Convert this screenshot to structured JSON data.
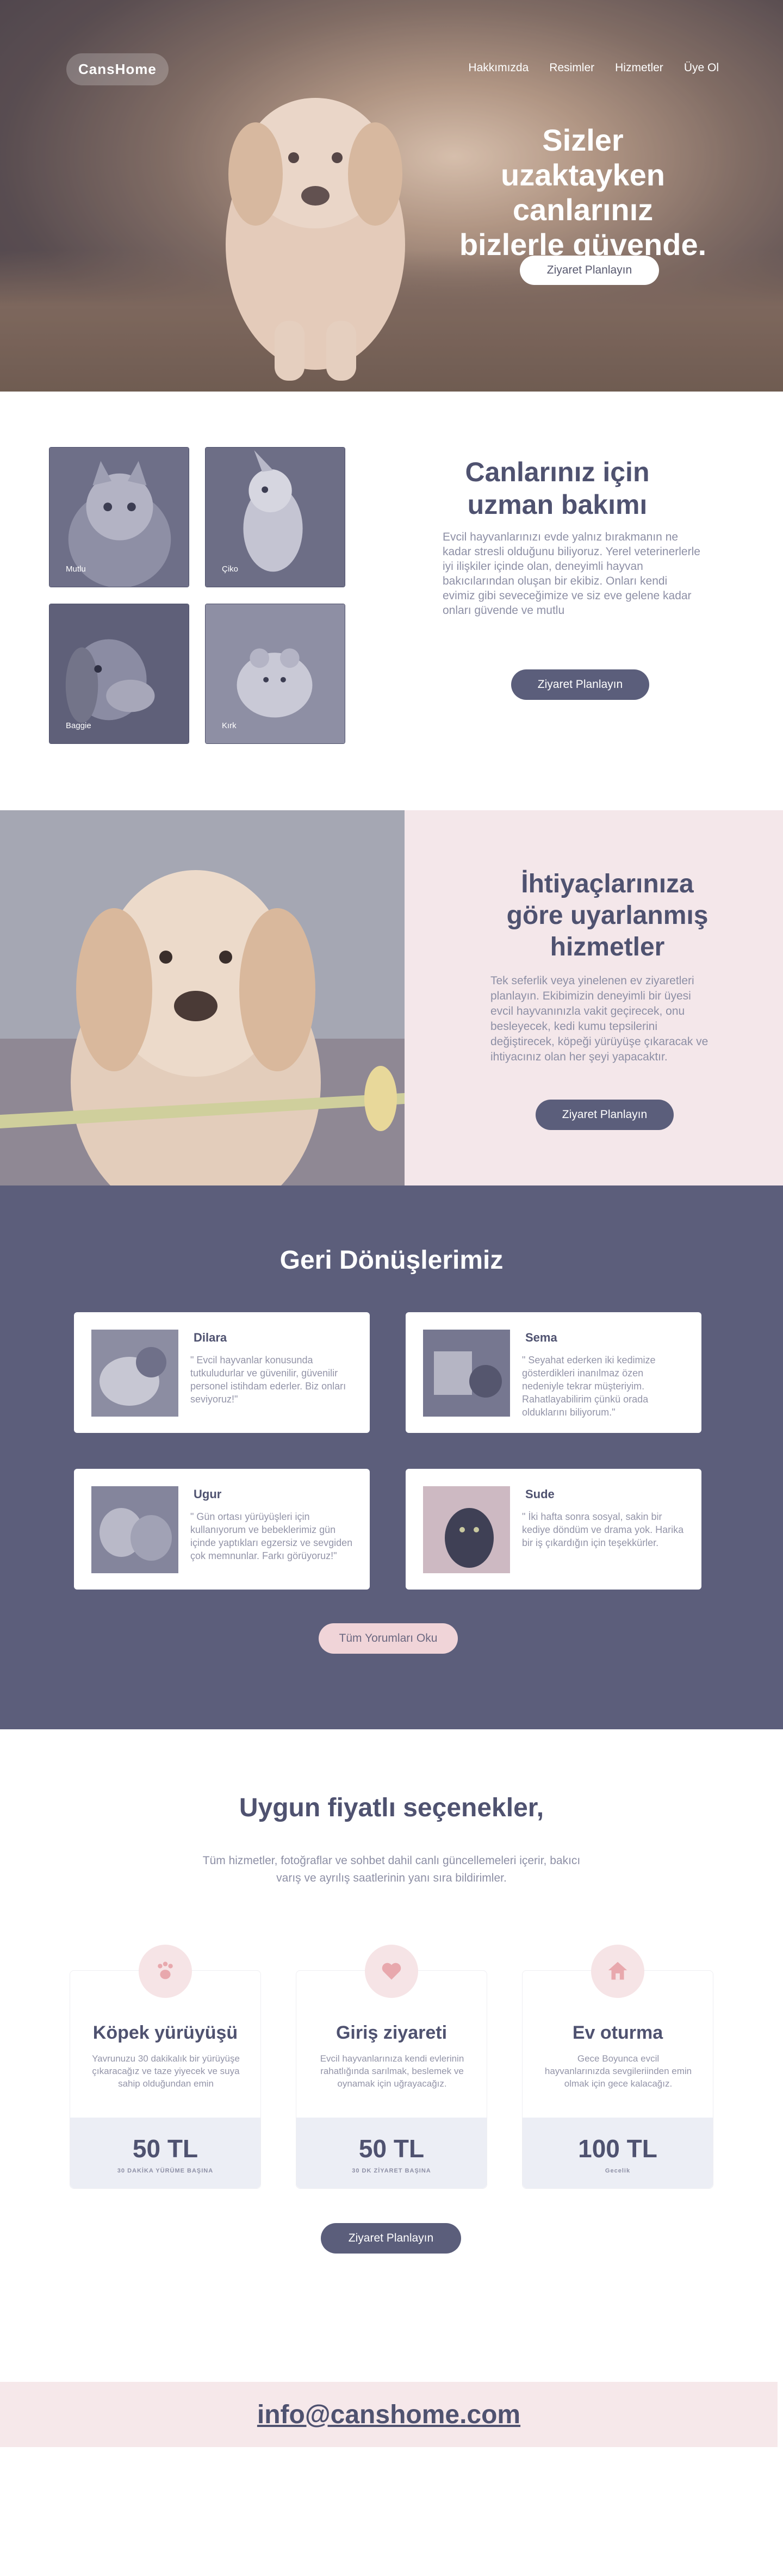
{
  "hero": {
    "logo": "CansHome",
    "nav": [
      "Hakkımızda",
      "Resimler",
      "Hizmetler",
      "Üye Ol"
    ],
    "headline": "Sizler uzaktayken canlarınız bizlerle güvende.",
    "cta": "Ziyaret Planlayın"
  },
  "care": {
    "pets": [
      "Mutlu",
      "Çiko",
      "Baggie",
      "Kırk"
    ],
    "title": "Canlarınız için uzman bakımı",
    "text": "Evcil hayvanlarınızı evde yalnız bırakmanın ne kadar stresli olduğunu biliyoruz. Yerel veterinerlerle iyi ilişkiler içinde olan, deneyimli hayvan bakıcılarından oluşan bir ekibiz. Onları kendi evimiz gibi seveceğimize ve siz eve gelene kadar onları güvende ve mutlu",
    "cta": "Ziyaret Planlayın"
  },
  "services": {
    "title": "İhtiyaçlarınıza göre uyarlanmış hizmetler",
    "text": "Tek seferlik veya yinelenen ev ziyaretleri planlayın. Ekibimizin deneyimli bir üyesi evcil hayvanınızla vakit geçirecek, onu besleyecek, kedi kumu tepsilerini değiştirecek, köpeği yürüyüşe çıkaracak ve ihtiyacınız olan her şeyi yapacaktır.",
    "cta": "Ziyaret Planlayın"
  },
  "reviews": {
    "title": "Geri Dönüşlerimiz",
    "items": [
      {
        "name": "Dilara",
        "quote": "\" Evcil hayvanlar konusunda tutkuludurlar ve güvenilir, güvenilir personel istihdam ederler. Biz onları seviyoruz!\""
      },
      {
        "name": "Sema",
        "quote": "\" Seyahat ederken iki kedimize gösterdikleri inanılmaz özen nedeniyle tekrar müşteriyim. Rahatlayabilirim çünkü orada olduklarını biliyorum.\""
      },
      {
        "name": "Ugur",
        "quote": "\" Gün ortası yürüyüşleri için kullanıyorum ve bebeklerimiz gün içinde yaptıkları egzersiz ve sevgiden çok memnunlar. Farkı görüyoruz!\""
      },
      {
        "name": "Sude",
        "quote": "\" İki hafta sonra sosyal, sakin bir kediye döndüm ve drama yok. Harika bir iş çıkardığın için teşekkürler."
      }
    ],
    "cta": "Tüm Yorumları Oku"
  },
  "pricing": {
    "title": "Uygun fiyatlı seçenekler,",
    "subtitle": "Tüm hizmetler, fotoğraflar ve sohbet dahil canlı güncellemeleri içerir, bakıcı varış ve ayrılış saatlerinin yanı sıra bildirimler.",
    "plans": [
      {
        "name": "Köpek yürüyüşü",
        "desc": "Yavrunuzu 30 dakikalık bir yürüyüşe çıkaracağız ve taze yiyecek ve suya sahip olduğundan emin",
        "price": "50 TL",
        "unit": "30 DAKİKA YÜRÜME BAŞINA",
        "icon": "dog-icon"
      },
      {
        "name": "Giriş ziyareti",
        "desc": "Evcil hayvanlarınıza kendi evlerinin rahatlığında sarılmak, beslemek ve oynamak için uğrayacağız.",
        "price": "50 TL",
        "unit": "30 DK ZİYARET BAŞINA",
        "icon": "heart-hand-icon"
      },
      {
        "name": "Ev oturma",
        "desc": "Gece Boyunca evcil hayvanlarınızda sevgileriinden emin olmak için gece kalacağız.",
        "price": "100 TL",
        "unit": "Gecelik",
        "icon": "home-icon"
      }
    ],
    "cta": "Ziyaret Planlayın"
  },
  "footer": {
    "email": "info@canshome.com"
  }
}
